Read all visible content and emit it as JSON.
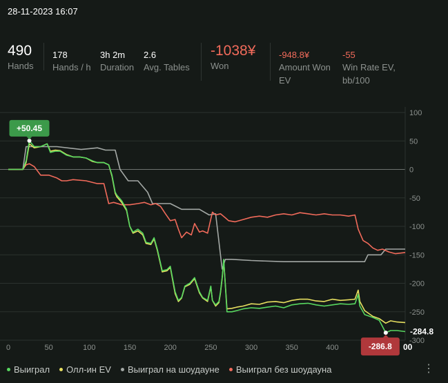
{
  "header": {
    "datetime": "28-11-2023 16:07"
  },
  "stats": {
    "hands": {
      "value": "490",
      "label": "Hands"
    },
    "hands_per_hour": {
      "value": "178",
      "label": "Hands / h"
    },
    "duration": {
      "value": "3h 2m",
      "label": "Duration"
    },
    "avg_tables": {
      "value": "2.6",
      "label": "Avg. Tables"
    },
    "won": {
      "value": "-1038¥",
      "label": "Won"
    },
    "amount_won_ev": {
      "value": "-948.8¥",
      "label_line1": "Amount Won",
      "label_line2": "EV"
    },
    "win_rate_ev": {
      "value": "-55",
      "label_line1": "Win Rate EV,",
      "label_line2": "bb/100"
    }
  },
  "colors": {
    "green": "#58d860",
    "yellow": "#e8e060",
    "gray": "#a3a8a5",
    "red": "#f26b5b",
    "grid": "#2c322f",
    "zero": "#6f7571",
    "accent_green": "#3c9a4a",
    "accent_red": "#b0383b"
  },
  "chart_data": {
    "type": "line",
    "xlim": [
      0,
      490
    ],
    "ylim": [
      -300,
      100
    ],
    "x_ticks": [
      "0",
      "50",
      "100",
      "150",
      "200",
      "250",
      "300",
      "350",
      "400",
      "450"
    ],
    "y_ticks": [
      "100",
      "50",
      "0",
      "-50",
      "-100",
      "-150",
      "-200",
      "-250",
      "-300"
    ],
    "max_label": "+50.45",
    "max_point": {
      "x": 26,
      "y": 50.45
    },
    "min_label": "-286.8",
    "min_point": {
      "x": 466,
      "y": -286.8
    },
    "end_label": "-284.8",
    "end_partial_label": "00",
    "legend_placement": "bottom",
    "series": [
      {
        "name": "Выиграл",
        "color_key": "green",
        "points": [
          [
            0,
            0
          ],
          [
            8,
            0
          ],
          [
            18,
            0
          ],
          [
            22,
            15
          ],
          [
            26,
            50.45
          ],
          [
            32,
            40
          ],
          [
            40,
            40
          ],
          [
            48,
            45
          ],
          [
            52,
            30
          ],
          [
            58,
            32
          ],
          [
            64,
            32
          ],
          [
            72,
            25
          ],
          [
            80,
            22
          ],
          [
            88,
            22
          ],
          [
            96,
            20
          ],
          [
            104,
            15
          ],
          [
            110,
            12
          ],
          [
            118,
            12
          ],
          [
            124,
            8
          ],
          [
            128,
            -10
          ],
          [
            132,
            -40
          ],
          [
            134,
            -45
          ],
          [
            140,
            -55
          ],
          [
            146,
            -70
          ],
          [
            150,
            -100
          ],
          [
            154,
            -110
          ],
          [
            160,
            -105
          ],
          [
            166,
            -112
          ],
          [
            170,
            -128
          ],
          [
            176,
            -130
          ],
          [
            180,
            -120
          ],
          [
            184,
            -140
          ],
          [
            190,
            -178
          ],
          [
            196,
            -176
          ],
          [
            200,
            -170
          ],
          [
            206,
            -215
          ],
          [
            210,
            -230
          ],
          [
            214,
            -225
          ],
          [
            218,
            -205
          ],
          [
            224,
            -200
          ],
          [
            230,
            -190
          ],
          [
            236,
            -215
          ],
          [
            240,
            -225
          ],
          [
            246,
            -230
          ],
          [
            250,
            -205
          ],
          [
            252,
            -230
          ],
          [
            256,
            -238
          ],
          [
            260,
            -232
          ],
          [
            262,
            -215
          ],
          [
            264,
            -190
          ],
          [
            266,
            -158
          ],
          [
            270,
            -250
          ],
          [
            276,
            -250
          ],
          [
            282,
            -248
          ],
          [
            290,
            -245
          ],
          [
            300,
            -243
          ],
          [
            310,
            -244
          ],
          [
            320,
            -242
          ],
          [
            330,
            -240
          ],
          [
            340,
            -243
          ],
          [
            350,
            -238
          ],
          [
            360,
            -236
          ],
          [
            370,
            -235
          ],
          [
            380,
            -238
          ],
          [
            390,
            -240
          ],
          [
            400,
            -238
          ],
          [
            410,
            -236
          ],
          [
            420,
            -237
          ],
          [
            428,
            -236
          ],
          [
            432,
            -220
          ],
          [
            434,
            -240
          ],
          [
            440,
            -255
          ],
          [
            450,
            -260
          ],
          [
            458,
            -265
          ],
          [
            466,
            -286.8
          ],
          [
            472,
            -283
          ],
          [
            480,
            -283
          ],
          [
            490,
            -284.8
          ]
        ]
      },
      {
        "name": "Олл-ин EV",
        "color_key": "yellow",
        "points": [
          [
            0,
            0
          ],
          [
            8,
            0
          ],
          [
            18,
            0
          ],
          [
            22,
            12
          ],
          [
            26,
            45
          ],
          [
            32,
            38
          ],
          [
            40,
            40
          ],
          [
            48,
            45
          ],
          [
            52,
            32
          ],
          [
            58,
            34
          ],
          [
            64,
            33
          ],
          [
            72,
            26
          ],
          [
            80,
            22
          ],
          [
            88,
            22
          ],
          [
            96,
            20
          ],
          [
            104,
            14
          ],
          [
            110,
            12
          ],
          [
            118,
            12
          ],
          [
            124,
            8
          ],
          [
            128,
            -12
          ],
          [
            132,
            -42
          ],
          [
            134,
            -48
          ],
          [
            140,
            -58
          ],
          [
            146,
            -72
          ],
          [
            150,
            -100
          ],
          [
            154,
            -112
          ],
          [
            160,
            -108
          ],
          [
            166,
            -115
          ],
          [
            170,
            -130
          ],
          [
            176,
            -132
          ],
          [
            180,
            -122
          ],
          [
            184,
            -142
          ],
          [
            190,
            -180
          ],
          [
            196,
            -178
          ],
          [
            200,
            -172
          ],
          [
            206,
            -218
          ],
          [
            210,
            -232
          ],
          [
            214,
            -226
          ],
          [
            218,
            -206
          ],
          [
            224,
            -202
          ],
          [
            230,
            -192
          ],
          [
            236,
            -217
          ],
          [
            240,
            -226
          ],
          [
            246,
            -232
          ],
          [
            250,
            -206
          ],
          [
            252,
            -230
          ],
          [
            256,
            -240
          ],
          [
            260,
            -234
          ],
          [
            262,
            -217
          ],
          [
            264,
            -192
          ],
          [
            266,
            -160
          ],
          [
            270,
            -245
          ],
          [
            276,
            -244
          ],
          [
            282,
            -242
          ],
          [
            290,
            -240
          ],
          [
            300,
            -236
          ],
          [
            310,
            -237
          ],
          [
            320,
            -233
          ],
          [
            330,
            -232
          ],
          [
            340,
            -234
          ],
          [
            350,
            -230
          ],
          [
            360,
            -228
          ],
          [
            370,
            -228
          ],
          [
            380,
            -231
          ],
          [
            390,
            -232
          ],
          [
            400,
            -228
          ],
          [
            410,
            -230
          ],
          [
            420,
            -229
          ],
          [
            428,
            -228
          ],
          [
            432,
            -212
          ],
          [
            434,
            -232
          ],
          [
            440,
            -248
          ],
          [
            450,
            -258
          ],
          [
            458,
            -262
          ],
          [
            466,
            -270
          ],
          [
            472,
            -266
          ],
          [
            480,
            -268
          ],
          [
            490,
            -269
          ]
        ]
      },
      {
        "name": "Выиграл на шоудауне",
        "color_key": "gray",
        "points": [
          [
            0,
            0
          ],
          [
            8,
            0
          ],
          [
            18,
            0
          ],
          [
            22,
            40
          ],
          [
            30,
            40
          ],
          [
            60,
            40
          ],
          [
            90,
            35
          ],
          [
            110,
            38
          ],
          [
            120,
            34
          ],
          [
            132,
            34
          ],
          [
            138,
            0
          ],
          [
            148,
            -20
          ],
          [
            160,
            -20
          ],
          [
            172,
            -40
          ],
          [
            178,
            -60
          ],
          [
            200,
            -60
          ],
          [
            214,
            -70
          ],
          [
            236,
            -70
          ],
          [
            248,
            -80
          ],
          [
            256,
            -78
          ],
          [
            264,
            -175
          ],
          [
            268,
            -158
          ],
          [
            276,
            -158
          ],
          [
            300,
            -160
          ],
          [
            340,
            -162
          ],
          [
            380,
            -162
          ],
          [
            440,
            -162
          ],
          [
            444,
            -150
          ],
          [
            460,
            -150
          ],
          [
            466,
            -140
          ],
          [
            490,
            -140
          ]
        ]
      },
      {
        "name": "Выиграл без шоудауна",
        "color_key": "red",
        "points": [
          [
            0,
            0
          ],
          [
            8,
            0
          ],
          [
            18,
            0
          ],
          [
            22,
            8
          ],
          [
            26,
            10
          ],
          [
            32,
            5
          ],
          [
            40,
            -10
          ],
          [
            50,
            -10
          ],
          [
            60,
            -15
          ],
          [
            66,
            -20
          ],
          [
            72,
            -20
          ],
          [
            80,
            -18
          ],
          [
            96,
            -20
          ],
          [
            110,
            -25
          ],
          [
            118,
            -25
          ],
          [
            124,
            -60
          ],
          [
            130,
            -58
          ],
          [
            140,
            -62
          ],
          [
            150,
            -62
          ],
          [
            160,
            -60
          ],
          [
            168,
            -58
          ],
          [
            176,
            -62
          ],
          [
            182,
            -60
          ],
          [
            188,
            -65
          ],
          [
            194,
            -78
          ],
          [
            200,
            -90
          ],
          [
            206,
            -88
          ],
          [
            210,
            -105
          ],
          [
            214,
            -120
          ],
          [
            220,
            -110
          ],
          [
            226,
            -115
          ],
          [
            230,
            -95
          ],
          [
            236,
            -110
          ],
          [
            240,
            -108
          ],
          [
            246,
            -112
          ],
          [
            252,
            -75
          ],
          [
            256,
            -80
          ],
          [
            262,
            -78
          ],
          [
            268,
            -85
          ],
          [
            272,
            -90
          ],
          [
            280,
            -92
          ],
          [
            290,
            -88
          ],
          [
            300,
            -84
          ],
          [
            310,
            -82
          ],
          [
            320,
            -84
          ],
          [
            330,
            -80
          ],
          [
            340,
            -78
          ],
          [
            350,
            -80
          ],
          [
            360,
            -76
          ],
          [
            370,
            -78
          ],
          [
            380,
            -80
          ],
          [
            390,
            -78
          ],
          [
            400,
            -80
          ],
          [
            410,
            -80
          ],
          [
            420,
            -82
          ],
          [
            428,
            -80
          ],
          [
            432,
            -105
          ],
          [
            438,
            -125
          ],
          [
            444,
            -130
          ],
          [
            450,
            -138
          ],
          [
            456,
            -142
          ],
          [
            462,
            -140
          ],
          [
            470,
            -145
          ],
          [
            478,
            -148
          ],
          [
            490,
            -146
          ]
        ]
      }
    ]
  },
  "legend": [
    {
      "label": "Выиграл",
      "color_key": "green"
    },
    {
      "label": "Олл-ин EV",
      "color_key": "yellow"
    },
    {
      "label": "Выиграл на шоудауне",
      "color_key": "gray"
    },
    {
      "label": "Выиграл без шоудауна",
      "color_key": "red"
    }
  ],
  "icons": {
    "more": "more-vertical-icon"
  }
}
